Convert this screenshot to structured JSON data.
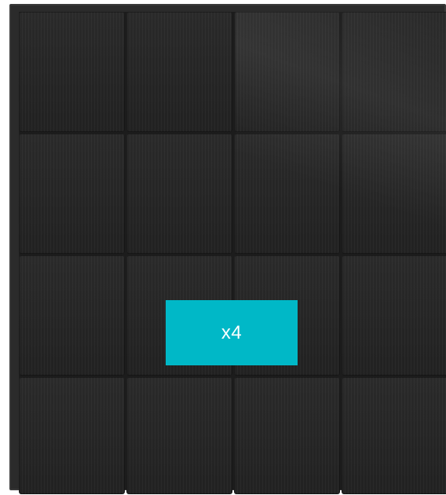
{
  "product": {
    "kind": "solar-panel",
    "cell_columns": 4,
    "cell_rows": 4,
    "frame_color": "#2b2b2b",
    "cell_color": "#232323"
  },
  "badge": {
    "label": "x4",
    "color": "#00b8c7",
    "text_color": "#ffffff"
  }
}
